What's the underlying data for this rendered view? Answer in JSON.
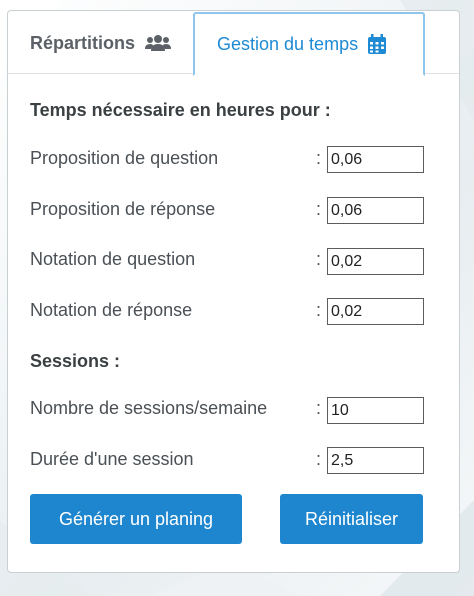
{
  "tabs": [
    {
      "label": "Répartitions",
      "icon": "users-icon",
      "active": false
    },
    {
      "label": "Gestion du temps",
      "icon": "calendar-icon",
      "active": true
    }
  ],
  "time_section": {
    "heading": "Temps nécessaire en heures pour :",
    "rows": [
      {
        "label": "Proposition de question",
        "value": "0,06"
      },
      {
        "label": "Proposition de réponse",
        "value": "0,06"
      },
      {
        "label": "Notation de question",
        "value": "0,02"
      },
      {
        "label": "Notation de réponse",
        "value": "0,02"
      }
    ]
  },
  "sessions_section": {
    "heading": "Sessions :",
    "rows": [
      {
        "label": "Nombre de sessions/semaine",
        "value": "10"
      },
      {
        "label": "Durée d'une session",
        "value": "2,5"
      }
    ]
  },
  "colon": ":",
  "buttons": {
    "generate": "Générer un planing",
    "reset": "Réinitialiser"
  },
  "colors": {
    "accent": "#1e86cf",
    "tab_active_text": "#1e8ad3",
    "tab_active_border": "#8fc5ea"
  }
}
